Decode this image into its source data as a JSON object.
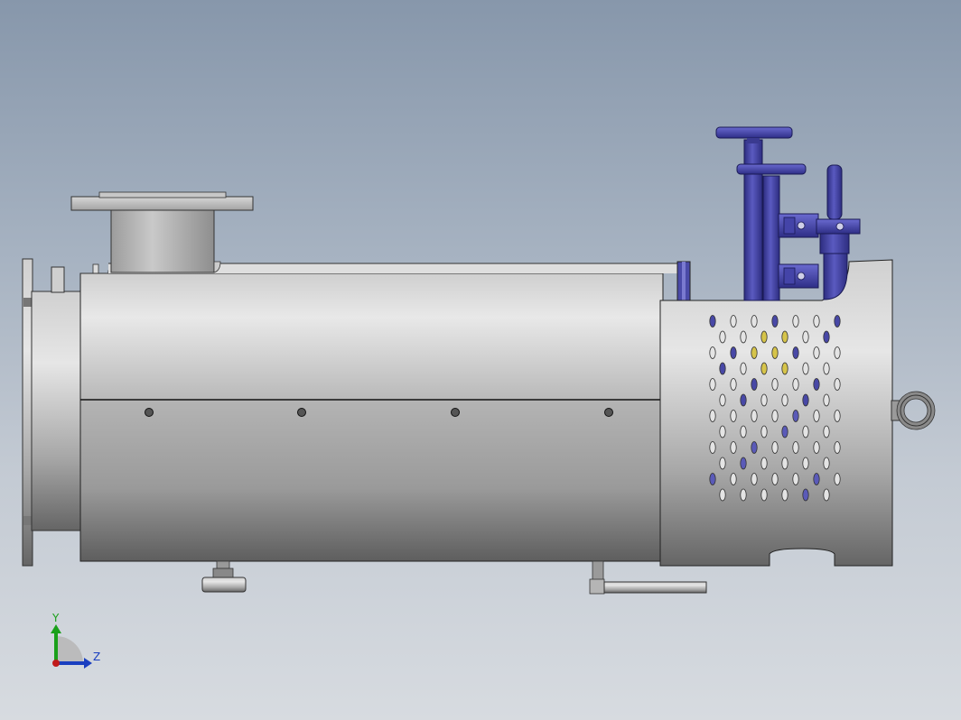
{
  "viewport": {
    "background_top": "#8797ab",
    "background_bottom": "#d7dbe0"
  },
  "model": {
    "body_color": "#bdbdbd",
    "valve_color": "#4848a6",
    "highlight_color": "#d6c44a"
  },
  "triad": {
    "y_label": "Y",
    "z_label": "Z",
    "y_color": "#1aa01a",
    "z_color": "#1a3fc0",
    "x_color": "#c01a1a"
  }
}
